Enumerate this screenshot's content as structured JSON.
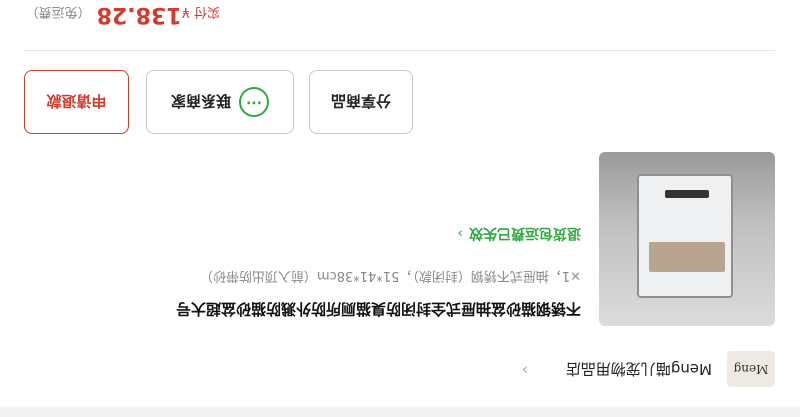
{
  "shop": {
    "logo_text": "Meng",
    "name": "Meng喵儿宠物用品店",
    "chevron": "›"
  },
  "product": {
    "title": "不锈钢猫砂盆抽屉式全封闭防臭猫厕所防外溅防猫砂盆超大号",
    "spec": "×1，抽屉式不锈钢（封闭款），51*41*38cm（前入顶出防带砂）",
    "return_text": "退货包运费已失效",
    "return_chevron": "›"
  },
  "actions": {
    "share_label": "分享商品",
    "contact_label": "联系商家",
    "contact_icon_glyph": "···",
    "refund_label": "申请退款"
  },
  "payment": {
    "label": "实付 ",
    "currency": "¥",
    "amount": "138.28",
    "note": "（免运费）"
  },
  "colors": {
    "accent_red": "#d33a2c",
    "accent_green": "#2eaa3e"
  }
}
